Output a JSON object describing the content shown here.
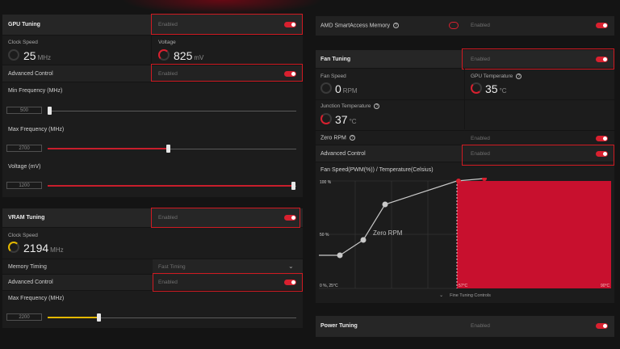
{
  "gpu_tuning": {
    "title": "GPU Tuning",
    "status": "Enabled",
    "clock_speed": {
      "label": "Clock Speed",
      "value": "25",
      "unit": "MHz"
    },
    "voltage": {
      "label": "Voltage",
      "value": "825",
      "unit": "mV"
    },
    "advanced_control": {
      "label": "Advanced Control",
      "status": "Enabled"
    },
    "min_freq": {
      "label": "Min Frequency (MHz)",
      "value": "500",
      "percent": 0
    },
    "max_freq": {
      "label": "Max Frequency (MHz)",
      "value": "2700",
      "percent": 49
    },
    "voltage_slider": {
      "label": "Voltage (mV)",
      "value": "1200",
      "percent": 100
    }
  },
  "vram_tuning": {
    "title": "VRAM Tuning",
    "status": "Enabled",
    "clock_speed": {
      "label": "Clock Speed",
      "value": "2194",
      "unit": "MHz"
    },
    "memory_timing": {
      "label": "Memory Timing",
      "value": "Fast Timing"
    },
    "advanced_control": {
      "label": "Advanced Control",
      "status": "Enabled"
    },
    "max_freq": {
      "label": "Max Frequency (MHz)",
      "value": "2200",
      "percent": 20
    }
  },
  "smart_access": {
    "label": "AMD SmartAccess Memory",
    "status": "Enabled"
  },
  "fan_tuning": {
    "title": "Fan Tuning",
    "status": "Enabled",
    "fan_speed": {
      "label": "Fan Speed",
      "value": "0",
      "unit": "RPM"
    },
    "gpu_temp": {
      "label": "GPU Temperature",
      "value": "35",
      "unit": "°C"
    },
    "junction_temp": {
      "label": "Junction Temperature",
      "value": "37",
      "unit": "°C"
    },
    "zero_rpm": {
      "label": "Zero RPM",
      "status": "Enabled"
    },
    "advanced_control": {
      "label": "Advanced Control",
      "status": "Enabled"
    },
    "curve": {
      "title": "Fan Speed(PWM(%)) / Temperature(Celsius)",
      "y_top": "100 %",
      "y_mid": "50 %",
      "origin": "0 %, 25°C",
      "zone_left": "57°C",
      "zone_right": "90°C",
      "zero_rpm_label": "Zero RPM",
      "fine_tuning": "Fine Tuning Controls"
    }
  },
  "power_tuning": {
    "title": "Power Tuning",
    "status": "Enabled"
  },
  "colors": {
    "accent": "#d9202f",
    "panel": "#1c1c1c",
    "header": "#262626",
    "vram_accent": "#e4b800"
  },
  "icons": [
    "info-icon",
    "smartaccess-icon",
    "chevron-down-icon"
  ]
}
